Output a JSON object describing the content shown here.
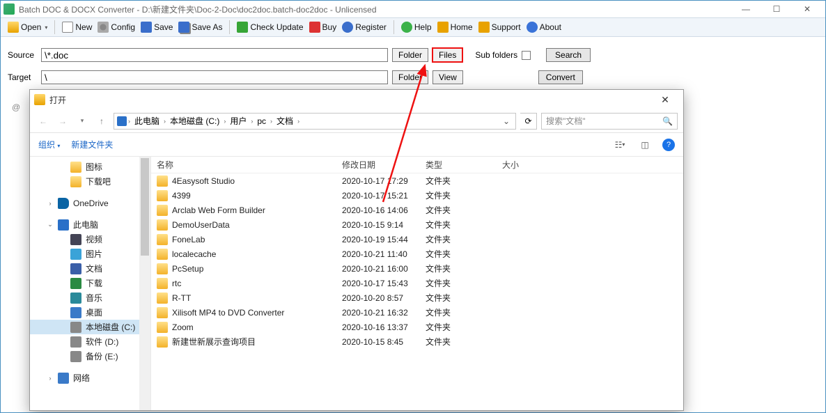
{
  "title": "Batch DOC & DOCX Converter - D:\\新建文件夹\\Doc-2-Doc\\doc2doc.batch-doc2doc - Unlicensed",
  "toolbar": {
    "open": "Open",
    "new": "New",
    "config": "Config",
    "save": "Save",
    "saveas": "Save As",
    "check": "Check Update",
    "buy": "Buy",
    "register": "Register",
    "help": "Help",
    "home": "Home",
    "support": "Support",
    "about": "About"
  },
  "form": {
    "source_label": "Source",
    "source_value": "\\*.doc",
    "target_label": "Target",
    "target_value": "\\",
    "folder_btn": "Folder",
    "files_btn": "Files",
    "view_btn": "View",
    "subfolders_label": "Sub folders",
    "search_btn": "Search",
    "convert_btn": "Convert"
  },
  "dialog": {
    "title": "打开",
    "breadcrumb": [
      "此电脑",
      "本地磁盘 (C:)",
      "用户",
      "pc",
      "文档"
    ],
    "search_placeholder": "搜索\"文档\"",
    "organize": "组织",
    "newfolder": "新建文件夹",
    "columns": {
      "name": "名称",
      "date": "修改日期",
      "type": "类型",
      "size": "大小"
    },
    "tree": [
      {
        "label": "图标",
        "icon": "folder",
        "indent": 1
      },
      {
        "label": "下载吧",
        "icon": "folder",
        "indent": 1
      },
      {
        "label": "OneDrive",
        "icon": "onedrive",
        "indent": 0,
        "expandable": true,
        "spaced": true
      },
      {
        "label": "此电脑",
        "icon": "pc",
        "indent": 0,
        "expandable": true,
        "expanded": true,
        "spaced": true
      },
      {
        "label": "视频",
        "icon": "video",
        "indent": 1
      },
      {
        "label": "图片",
        "icon": "picture",
        "indent": 1
      },
      {
        "label": "文档",
        "icon": "doc",
        "indent": 1
      },
      {
        "label": "下载",
        "icon": "download",
        "indent": 1
      },
      {
        "label": "音乐",
        "icon": "music",
        "indent": 1
      },
      {
        "label": "桌面",
        "icon": "desktop",
        "indent": 1
      },
      {
        "label": "本地磁盘 (C:)",
        "icon": "drive",
        "indent": 1,
        "selected": true
      },
      {
        "label": "软件 (D:)",
        "icon": "drive",
        "indent": 1
      },
      {
        "label": "备份 (E:)",
        "icon": "drive",
        "indent": 1
      },
      {
        "label": "网络",
        "icon": "network",
        "indent": 0,
        "expandable": true,
        "spaced": true
      }
    ],
    "files": [
      {
        "name": "4Easysoft Studio",
        "date": "2020-10-17 17:29",
        "type": "文件夹"
      },
      {
        "name": "4399",
        "date": "2020-10-17 15:21",
        "type": "文件夹"
      },
      {
        "name": "Arclab Web Form Builder",
        "date": "2020-10-16 14:06",
        "type": "文件夹"
      },
      {
        "name": "DemoUserData",
        "date": "2020-10-15 9:14",
        "type": "文件夹"
      },
      {
        "name": "FoneLab",
        "date": "2020-10-19 15:44",
        "type": "文件夹"
      },
      {
        "name": "localecache",
        "date": "2020-10-21 11:40",
        "type": "文件夹"
      },
      {
        "name": "PcSetup",
        "date": "2020-10-21 16:00",
        "type": "文件夹"
      },
      {
        "name": "rtc",
        "date": "2020-10-17 15:43",
        "type": "文件夹"
      },
      {
        "name": "R-TT",
        "date": "2020-10-20 8:57",
        "type": "文件夹"
      },
      {
        "name": "Xilisoft MP4 to DVD Converter",
        "date": "2020-10-21 16:32",
        "type": "文件夹"
      },
      {
        "name": "Zoom",
        "date": "2020-10-16 13:37",
        "type": "文件夹"
      },
      {
        "name": "新建世新展示查询项目",
        "date": "2020-10-15 8:45",
        "type": "文件夹"
      }
    ]
  }
}
